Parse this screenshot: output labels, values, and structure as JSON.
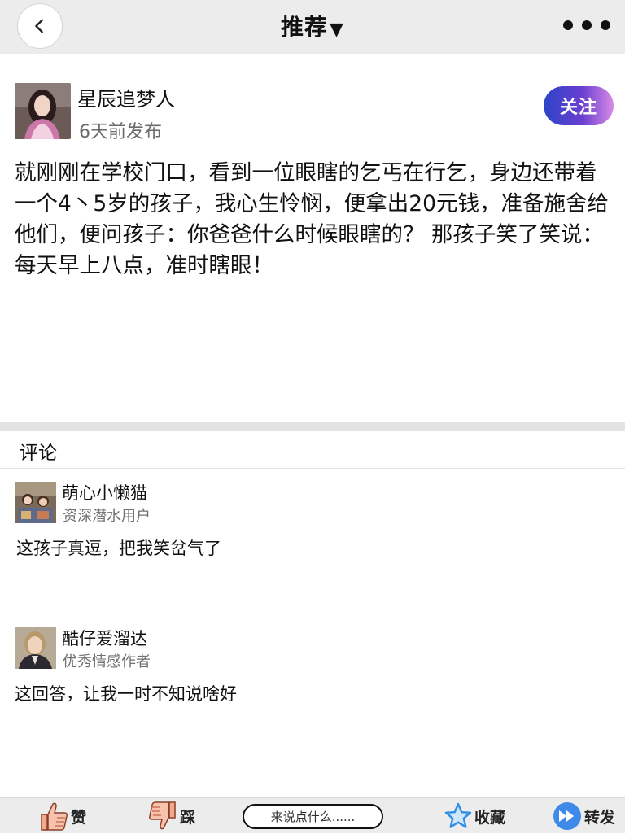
{
  "header": {
    "title": "推荐",
    "caret": "▼"
  },
  "post": {
    "author_name": "星辰追梦人",
    "time": "6天前发布",
    "follow_label": "关注",
    "body": "就刚刚在学校门口，看到一位眼瞎的乞丐在行乞，身边还带着一个4丶5岁的孩子，我心生怜悯，便拿出20元钱，准备施舍给他们，便问孩子：你爸爸什么时候眼瞎的？ 那孩子笑了笑说：每天早上八点，准时瞎眼！"
  },
  "comments": {
    "heading": "评论",
    "items": [
      {
        "name": "萌心小懒猫",
        "title": "资深潜水用户",
        "text": "这孩子真逗，把我笑岔气了"
      },
      {
        "name": "酷仔爱溜达",
        "title": "优秀情感作者",
        "text": "这回答，让我一时不知说啥好"
      }
    ]
  },
  "toolbar": {
    "like_label": "赞",
    "dislike_label": "踩",
    "comment_placeholder": "来说点什么......",
    "favorite_label": "收藏",
    "share_label": "转发"
  },
  "icons": {
    "back": "chevron-left-icon",
    "more": "more-dots-icon",
    "like": "thumbs-up-icon",
    "dislike": "thumbs-down-icon",
    "favorite": "star-icon",
    "share": "fast-forward-icon"
  },
  "colors": {
    "follow_gradient_start": "#2c44c8",
    "follow_gradient_end": "#d78be6",
    "star": "#2f8de4",
    "share": "#3f8ae8",
    "thumb": "#f3a98c"
  }
}
